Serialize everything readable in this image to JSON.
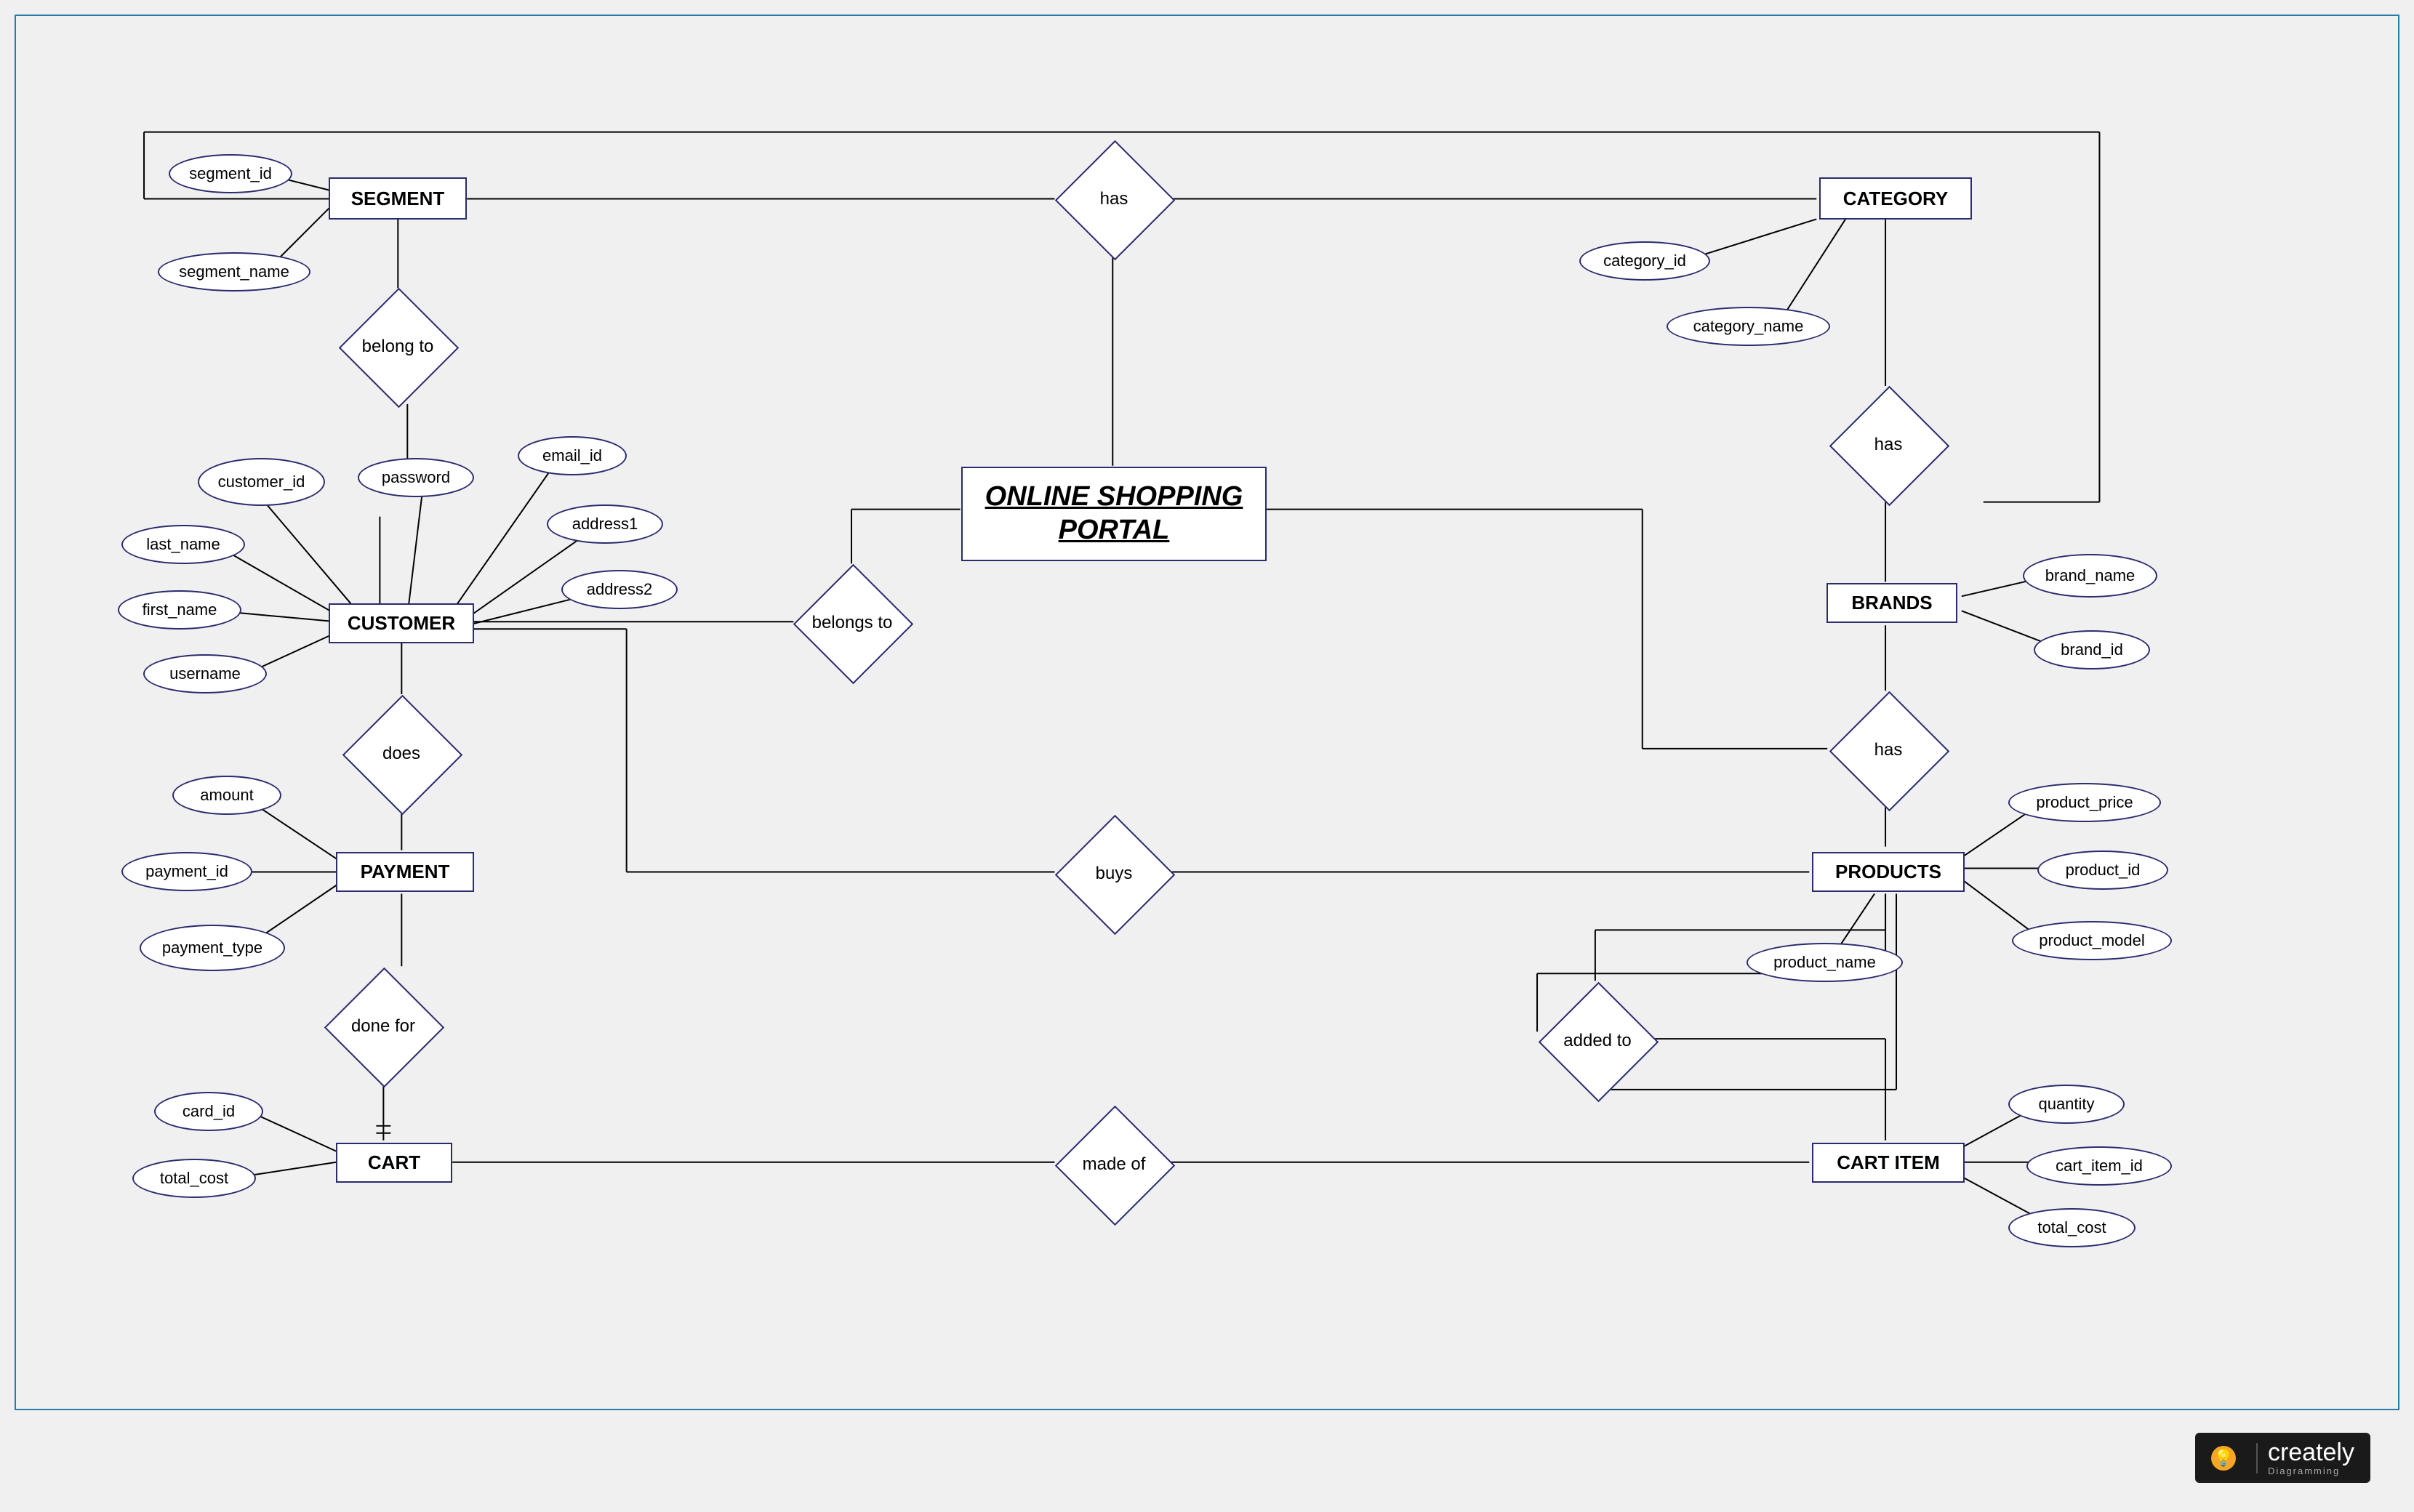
{
  "title": "ONLINE SHOPPING PORTAL",
  "logo": {
    "brand": "creately",
    "sub": "Diagramming"
  },
  "entities": {
    "segment": "SEGMENT",
    "category": "CATEGORY",
    "customer": "CUSTOMER",
    "brands": "BRANDS",
    "payment": "PAYMENT",
    "products": "PRODUCTS",
    "cart": "CART",
    "cart_item": "CART ITEM"
  },
  "relationships": {
    "has_top": "has",
    "belong_to": "belong to",
    "has_cat_brand": "has",
    "belongs_to": "belongs to",
    "does": "does",
    "has_brand_prod": "has",
    "buys": "buys",
    "done_for": "done for",
    "added_to": "added to",
    "made_of": "made of"
  },
  "attributes": {
    "segment_id": "segment_id",
    "segment_name": "segment_name",
    "category_id": "category_id",
    "category_name": "category_name",
    "customer_id": "customer_id",
    "password": "password",
    "email_id": "email_id",
    "last_name": "last_name",
    "address1": "address1",
    "first_name": "first_name",
    "address2": "address2",
    "username": "username",
    "brand_name": "brand_name",
    "brand_id": "brand_id",
    "amount": "amount",
    "payment_id": "payment_id",
    "payment_type": "payment_type",
    "product_price": "product_price",
    "product_id": "product_id",
    "product_model": "product_model",
    "product_name": "product_name",
    "card_id": "card_id",
    "total_cost_cart": "total_cost",
    "quantity": "quantity",
    "cart_item_id": "cart_item_id",
    "total_cost_item": "total_cost"
  }
}
